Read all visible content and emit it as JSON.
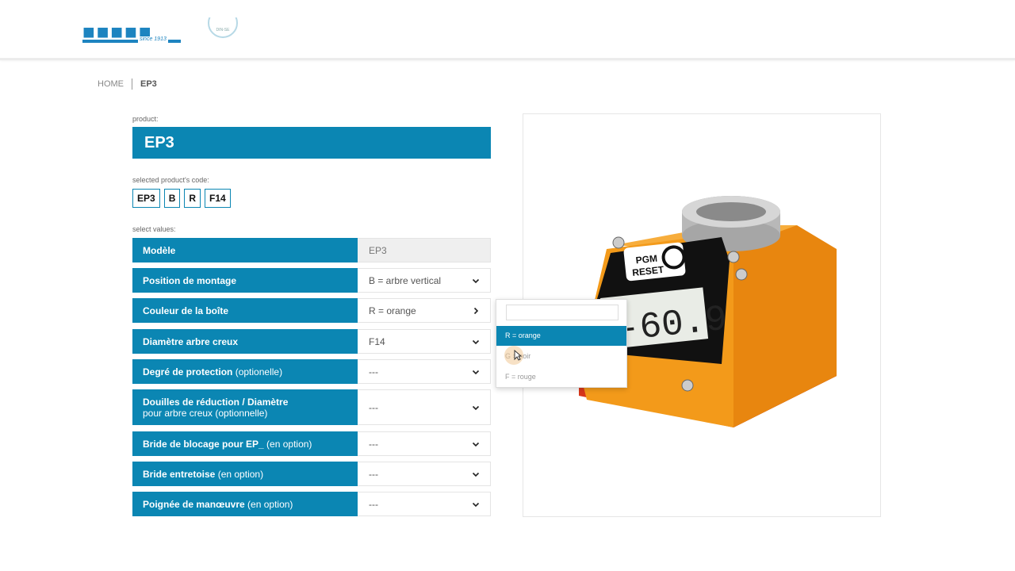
{
  "header": {
    "logo_tagline": "since 1913",
    "badge_text": "DIN-SE"
  },
  "breadcrumb": {
    "home": "HOME",
    "current": "EP3"
  },
  "form": {
    "product_label": "product:",
    "product_name": "EP3",
    "code_label": "selected product's code:",
    "codes": [
      "EP3",
      "B",
      "R",
      "F14"
    ],
    "select_label": "select values:",
    "rows": [
      {
        "label": "Modèle",
        "sub": "",
        "value": "EP3"
      },
      {
        "label": "Position de montage",
        "sub": "",
        "value": "B = arbre vertical"
      },
      {
        "label": "Couleur de la boîte",
        "sub": "",
        "value": "R = orange"
      },
      {
        "label": "Diamètre arbre creux",
        "sub": "",
        "value": "F14"
      },
      {
        "label": "Degré de protection",
        "sub": "(optionelle)",
        "value": "---"
      },
      {
        "label": "Douilles de réduction / Diamètre",
        "sub": "pour arbre creux (optionnelle)",
        "value": "---"
      },
      {
        "label": "Bride de blocage pour EP_",
        "sub": "(en option)",
        "value": "---"
      },
      {
        "label": "Bride entretoise",
        "sub": "(en option)",
        "value": "---"
      },
      {
        "label": "Poignée de manœuvre",
        "sub": "(en option)",
        "value": "---"
      }
    ]
  },
  "dropdown": {
    "options": [
      "R = orange",
      "G = noir",
      "F = rouge"
    ],
    "selected": "R = orange"
  },
  "product_image": {
    "display_top": "PGM",
    "display_bottom": "RESET",
    "display_value": "-60.9",
    "colors": {
      "body": "#f39a1a",
      "base": "#d8361a",
      "screen": "#111111",
      "accent": "#0b86b3"
    }
  }
}
